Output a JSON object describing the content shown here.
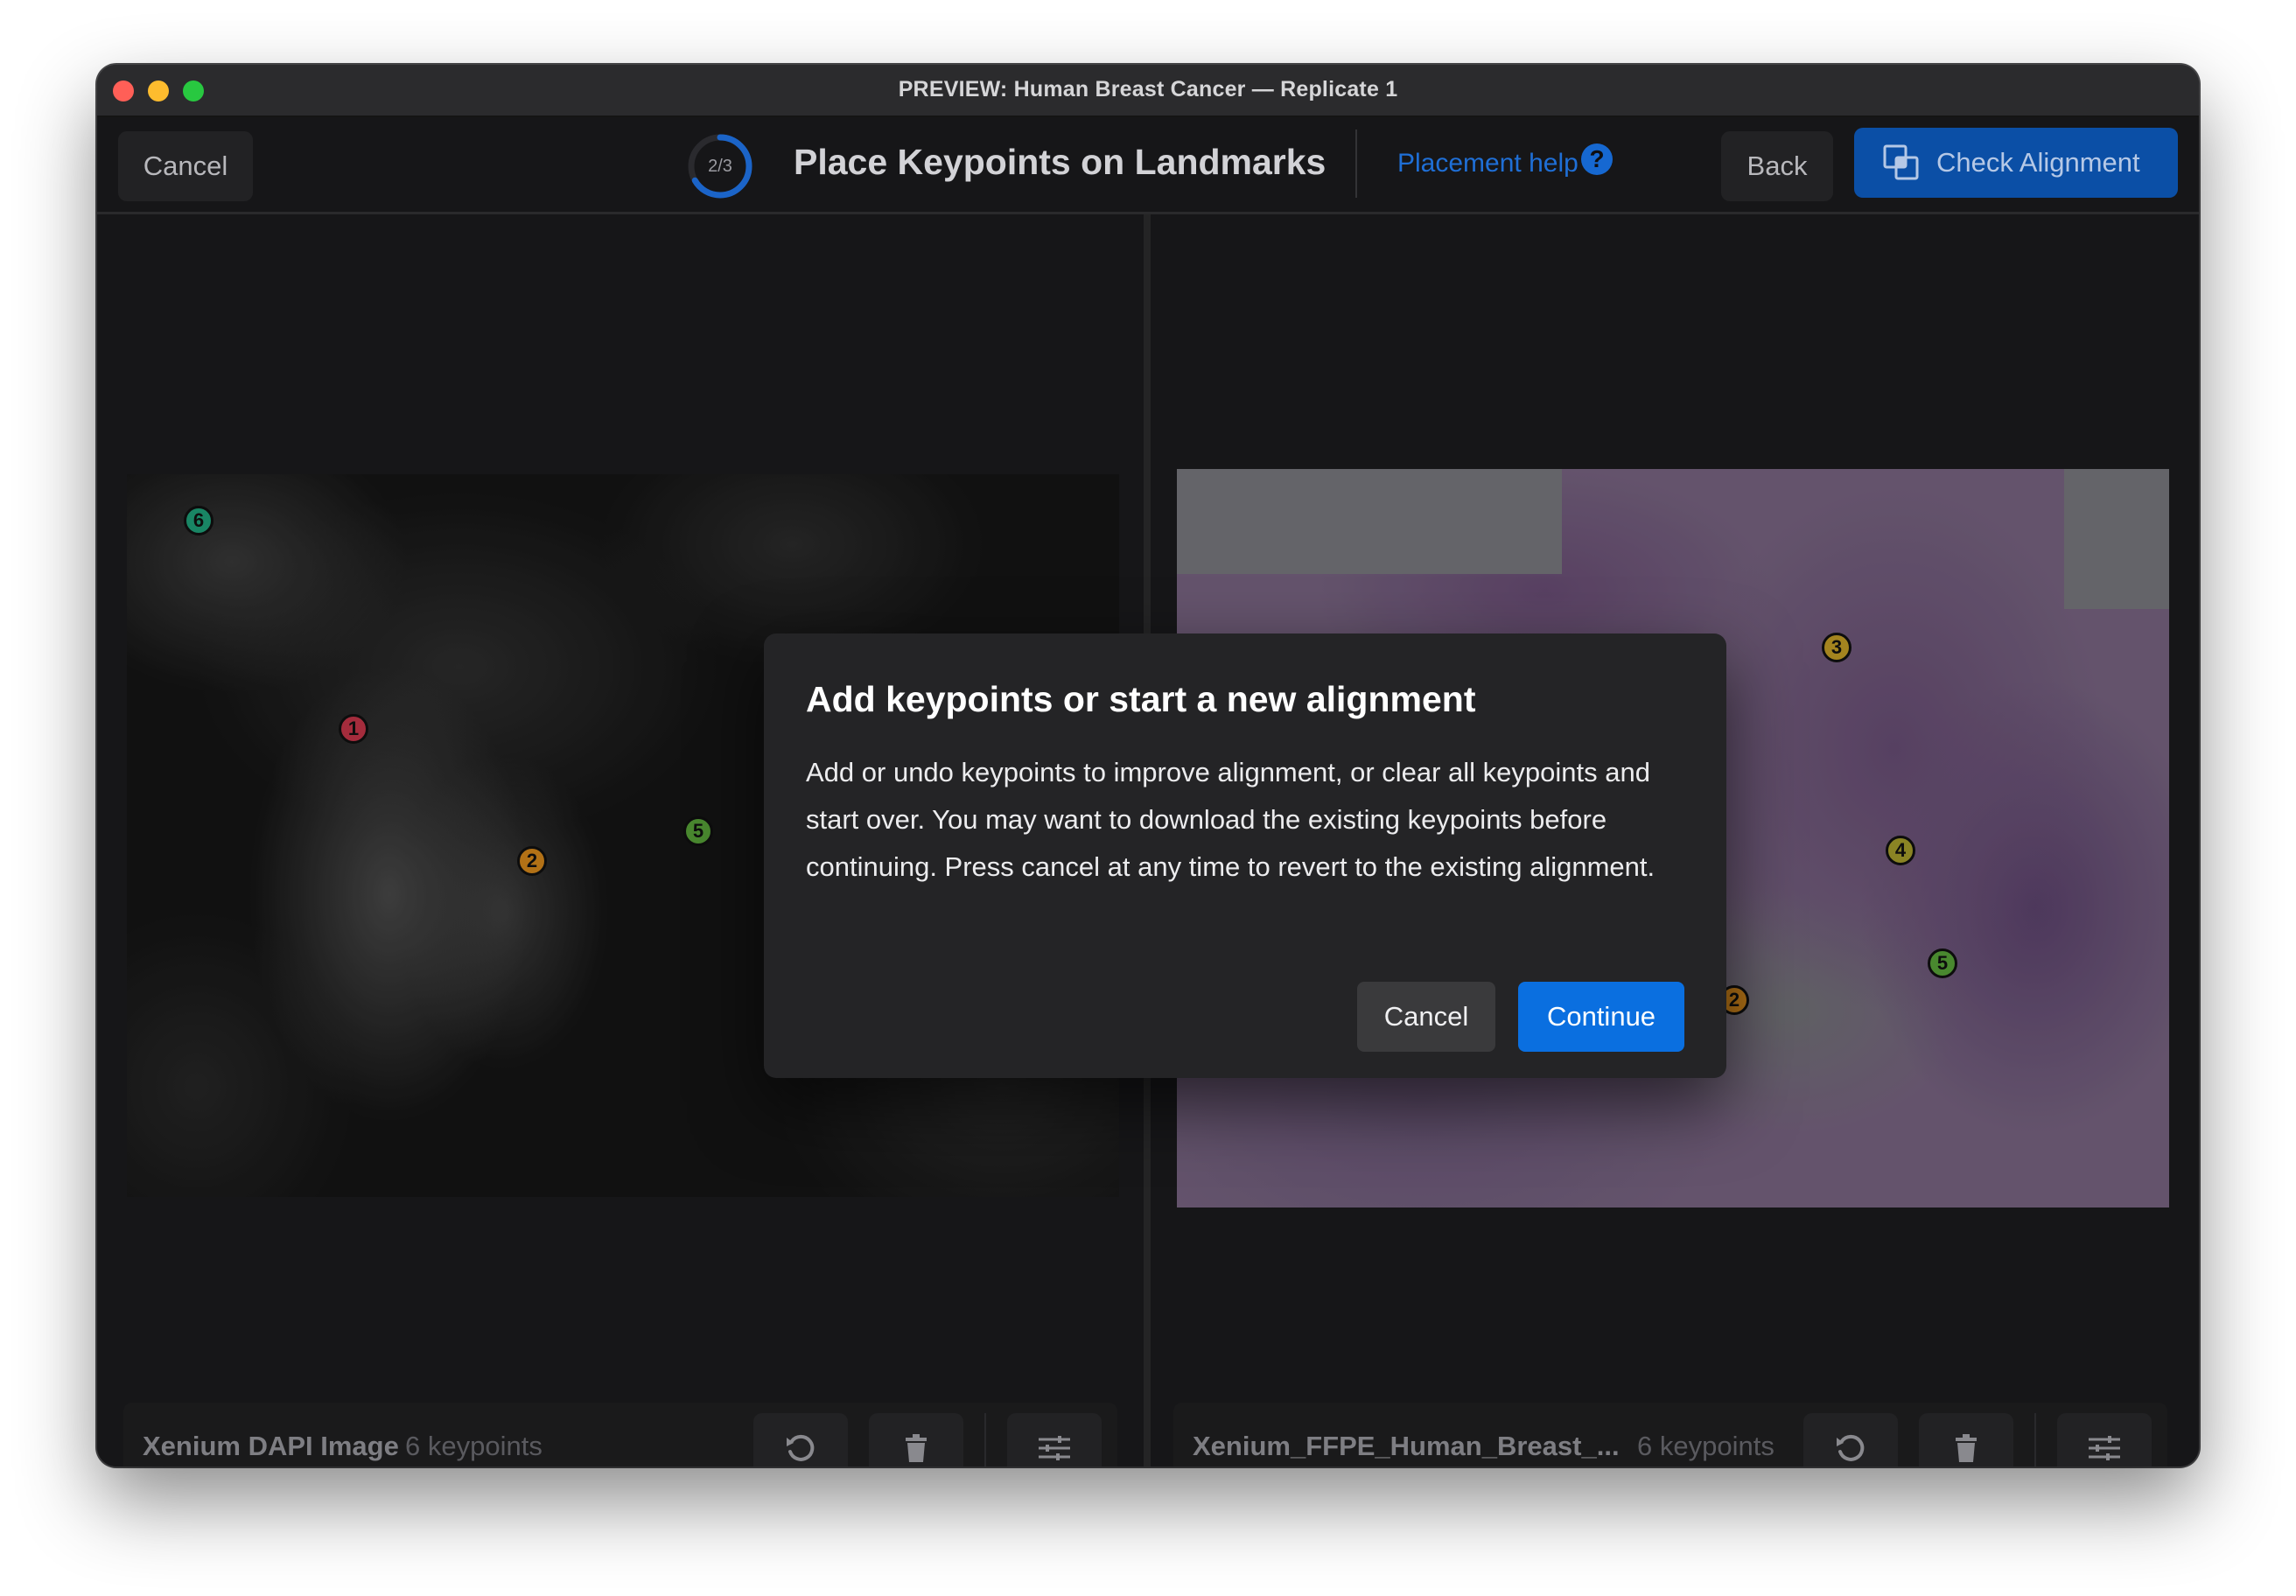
{
  "window": {
    "title": "PREVIEW: Human Breast Cancer — Replicate 1"
  },
  "toolbar": {
    "cancel_label": "Cancel",
    "step": "2/3",
    "step_progress": 0.667,
    "title": "Place Keypoints on Landmarks",
    "help_label": "Placement help",
    "help_icon": "?",
    "back_label": "Back",
    "check_label": "Check Alignment"
  },
  "left_panel": {
    "name": "Xenium DAPI Image",
    "count": "6 keypoints",
    "keypoints": [
      {
        "label": "6",
        "color": "#1fa37a"
      },
      {
        "label": "1",
        "color": "#c8364a"
      },
      {
        "label": "5",
        "color": "#5aa63a"
      },
      {
        "label": "2",
        "color": "#d98a1c"
      }
    ]
  },
  "right_panel": {
    "name": "Xenium_FFPE_Human_Breast_...",
    "count": "6 keypoints",
    "keypoints": [
      {
        "label": "3",
        "color": "#c9a227"
      },
      {
        "label": "4",
        "color": "#a9a22c"
      },
      {
        "label": "5",
        "color": "#5aa63a"
      },
      {
        "label": "2",
        "color": "#d98a1c"
      }
    ]
  },
  "modal": {
    "title": "Add keypoints or start a new alignment",
    "body": "Add or undo keypoints to improve alignment, or clear all keypoints and start over. You may want to download the existing keypoints before continuing. Press cancel at any time to revert to the existing alignment.",
    "cancel_label": "Cancel",
    "continue_label": "Continue"
  },
  "colors": {
    "accent": "#0a6fe0",
    "background": "#1c1c1e"
  }
}
